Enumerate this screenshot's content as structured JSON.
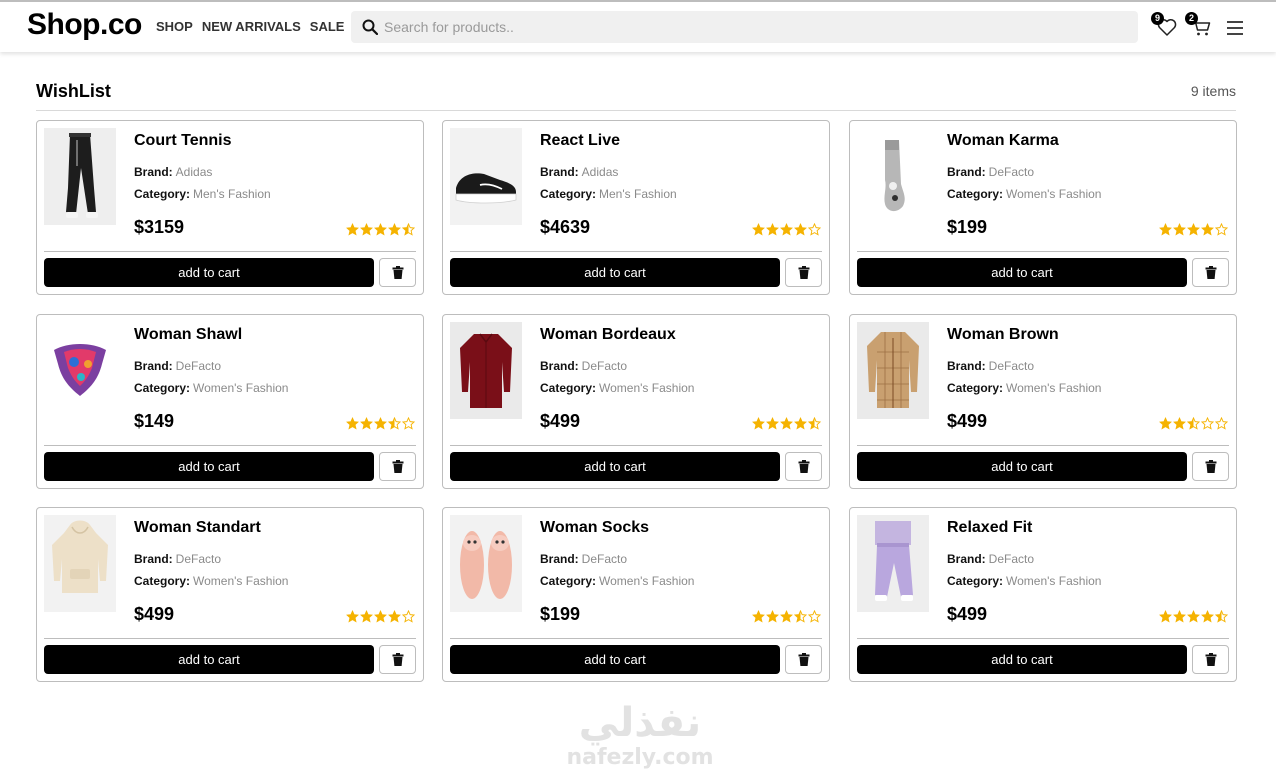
{
  "header": {
    "logo": "Shop.co",
    "nav": [
      "SHOP",
      "NEW ARRIVALS",
      "SALE"
    ],
    "search_placeholder": "Search for products..",
    "wishlist_count": "9",
    "cart_count": "2"
  },
  "wishlist": {
    "title": "WishList",
    "count_label": "9 items",
    "brand_label": "Brand:",
    "category_label": "Category:",
    "add_label": "add to cart",
    "items": [
      {
        "name": "Court Tennis",
        "brand": "Adidas",
        "category": "Men's Fashion",
        "price": "$3159",
        "rating": 4.5,
        "image": "pants"
      },
      {
        "name": "React Live",
        "brand": "Adidas",
        "category": "Men's Fashion",
        "price": "$4639",
        "rating": 4,
        "image": "sneaker"
      },
      {
        "name": "Woman Karma",
        "brand": "DeFacto",
        "category": "Women's Fashion",
        "price": "$199",
        "rating": 4,
        "image": "sock"
      },
      {
        "name": "Woman Shawl",
        "brand": "DeFacto",
        "category": "Women's Fashion",
        "price": "$149",
        "rating": 3.5,
        "image": "scarf"
      },
      {
        "name": "Woman Bordeaux",
        "brand": "DeFacto",
        "category": "Women's Fashion",
        "price": "$499",
        "rating": 4.5,
        "image": "shirt-red"
      },
      {
        "name": "Woman Brown",
        "brand": "DeFacto",
        "category": "Women's Fashion",
        "price": "$499",
        "rating": 2.5,
        "image": "shirt-plaid"
      },
      {
        "name": "Woman Standart",
        "brand": "DeFacto",
        "category": "Women's Fashion",
        "price": "$499",
        "rating": 4,
        "image": "hoodie"
      },
      {
        "name": "Woman Socks",
        "brand": "DeFacto",
        "category": "Women's Fashion",
        "price": "$199",
        "rating": 3.5,
        "image": "slippers"
      },
      {
        "name": "Relaxed Fit",
        "brand": "DeFacto",
        "category": "Women's Fashion",
        "price": "$499",
        "rating": 4.5,
        "image": "joggers"
      }
    ]
  },
  "watermark": {
    "arabic": "نفذلي",
    "latin": "nafezly.com"
  },
  "colors": {
    "star": "#f5b301",
    "button": "#000000",
    "border": "#bdbdbd"
  }
}
